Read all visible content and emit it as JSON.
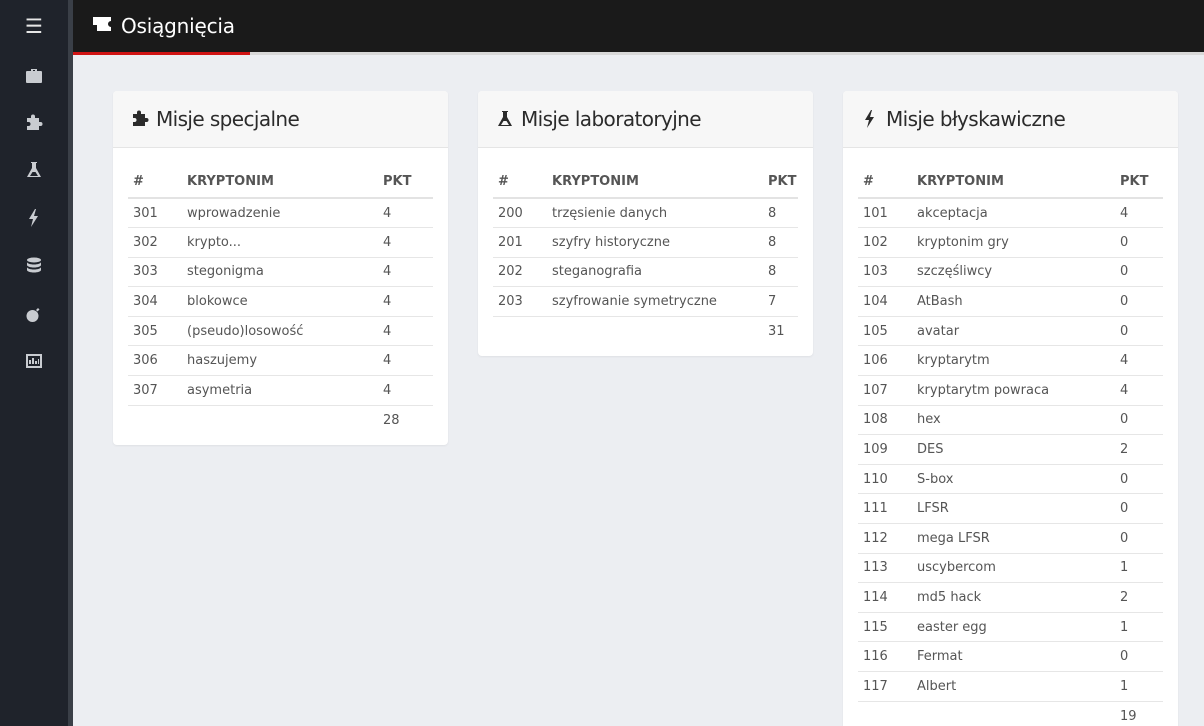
{
  "header": {
    "title": "Osiągnięcia"
  },
  "sidebar": {
    "items": [
      "briefcase-icon",
      "puzzle-icon",
      "flask-icon",
      "bolt-icon",
      "database-icon",
      "bomb-icon",
      "bar-chart-icon"
    ]
  },
  "columns": {
    "num": "#",
    "name": "KRYPTONIM",
    "pts": "PKT"
  },
  "cards": [
    {
      "title": "Misje specjalne",
      "icon": "puzzle-icon",
      "rows": [
        [
          "301",
          "wprowadzenie",
          "4"
        ],
        [
          "302",
          "krypto...",
          "4"
        ],
        [
          "303",
          "stegonigma",
          "4"
        ],
        [
          "304",
          "blokowce",
          "4"
        ],
        [
          "305",
          "(pseudo)losowość",
          "4"
        ],
        [
          "306",
          "haszujemy",
          "4"
        ],
        [
          "307",
          "asymetria",
          "4"
        ]
      ],
      "total": "28"
    },
    {
      "title": "Misje laboratoryjne",
      "icon": "flask-icon",
      "rows": [
        [
          "200",
          "trzęsienie danych",
          "8"
        ],
        [
          "201",
          "szyfry historyczne",
          "8"
        ],
        [
          "202",
          "steganografia",
          "8"
        ],
        [
          "203",
          "szyfrowanie symetryczne",
          "7"
        ]
      ],
      "total": "31"
    },
    {
      "title": "Misje błyskawiczne",
      "icon": "bolt-icon",
      "rows": [
        [
          "101",
          "akceptacja",
          "4"
        ],
        [
          "102",
          "kryptonim gry",
          "0"
        ],
        [
          "103",
          "szczęśliwcy",
          "0"
        ],
        [
          "104",
          "AtBash",
          "0"
        ],
        [
          "105",
          "avatar",
          "0"
        ],
        [
          "106",
          "kryptarytm",
          "4"
        ],
        [
          "107",
          "kryptarytm powraca",
          "4"
        ],
        [
          "108",
          "hex",
          "0"
        ],
        [
          "109",
          "DES",
          "2"
        ],
        [
          "110",
          "S-box",
          "0"
        ],
        [
          "111",
          "LFSR",
          "0"
        ],
        [
          "112",
          "mega LFSR",
          "0"
        ],
        [
          "113",
          "uscybercom",
          "1"
        ],
        [
          "114",
          "md5 hack",
          "2"
        ],
        [
          "115",
          "easter egg",
          "1"
        ],
        [
          "116",
          "Fermat",
          "0"
        ],
        [
          "117",
          "Albert",
          "1"
        ]
      ],
      "total": "19"
    }
  ]
}
